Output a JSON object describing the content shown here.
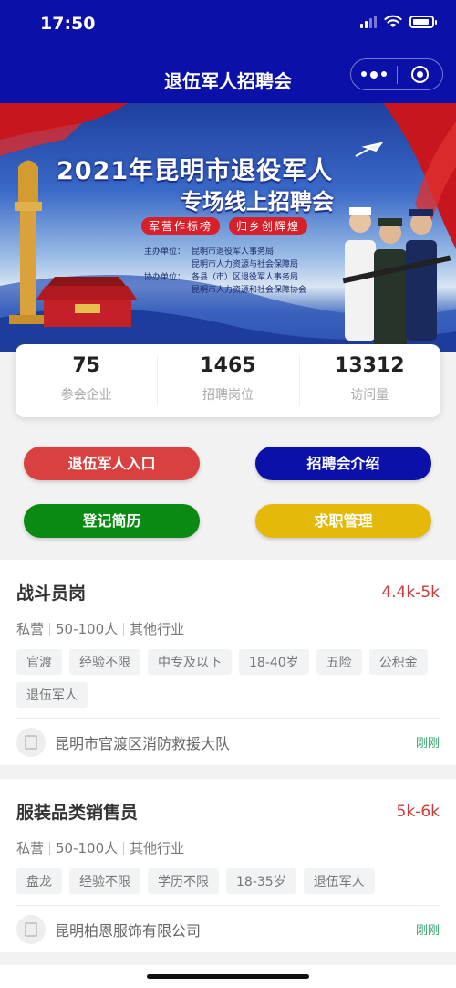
{
  "status": {
    "time": "17:50"
  },
  "nav": {
    "title": "退伍军人招聘会"
  },
  "banner": {
    "title": "2021年昆明市退役军人",
    "subtitle": "专场线上招聘会",
    "slogans": [
      "军营作标榜",
      "归乡创辉煌"
    ],
    "organizers": [
      {
        "label": "主办单位：",
        "value": "昆明市退役军人事务局"
      },
      {
        "label": "",
        "value": "昆明市人力资源与社会保障局"
      },
      {
        "label": "协办单位：",
        "value": "各县（市）区退役军人事务局"
      },
      {
        "label": "",
        "value": "昆明市人力资源和社会保障协会"
      }
    ]
  },
  "stats": [
    {
      "value": "75",
      "label": "参会企业"
    },
    {
      "value": "1465",
      "label": "招聘岗位"
    },
    {
      "value": "13312",
      "label": "访问量"
    }
  ],
  "actions": {
    "veteran_entry": "退伍军人入口",
    "fair_intro": "招聘会介绍",
    "register_resume": "登记简历",
    "job_manage": "求职管理"
  },
  "jobs": [
    {
      "title": "战斗员岗",
      "salary": "4.4k-5k",
      "meta": [
        "私营",
        "50-100人",
        "其他行业"
      ],
      "tags": [
        "官渡",
        "经验不限",
        "中专及以下",
        "18-40岁",
        "五险",
        "公积金",
        "退伍军人"
      ],
      "company": "昆明市官渡区消防救援大队",
      "time": "刚刚"
    },
    {
      "title": "服装品类销售员",
      "salary": "5k-6k",
      "meta": [
        "私营",
        "50-100人",
        "其他行业"
      ],
      "tags": [
        "盘龙",
        "经验不限",
        "学历不限",
        "18-35岁",
        "退伍军人"
      ],
      "company": "昆明柏恩服饰有限公司",
      "time": "刚刚"
    }
  ],
  "colors": {
    "primary": "#0a10a8",
    "red": "#d94141",
    "green": "#0a8a12",
    "yellow": "#e4b90a",
    "salary": "#d03a3a"
  }
}
